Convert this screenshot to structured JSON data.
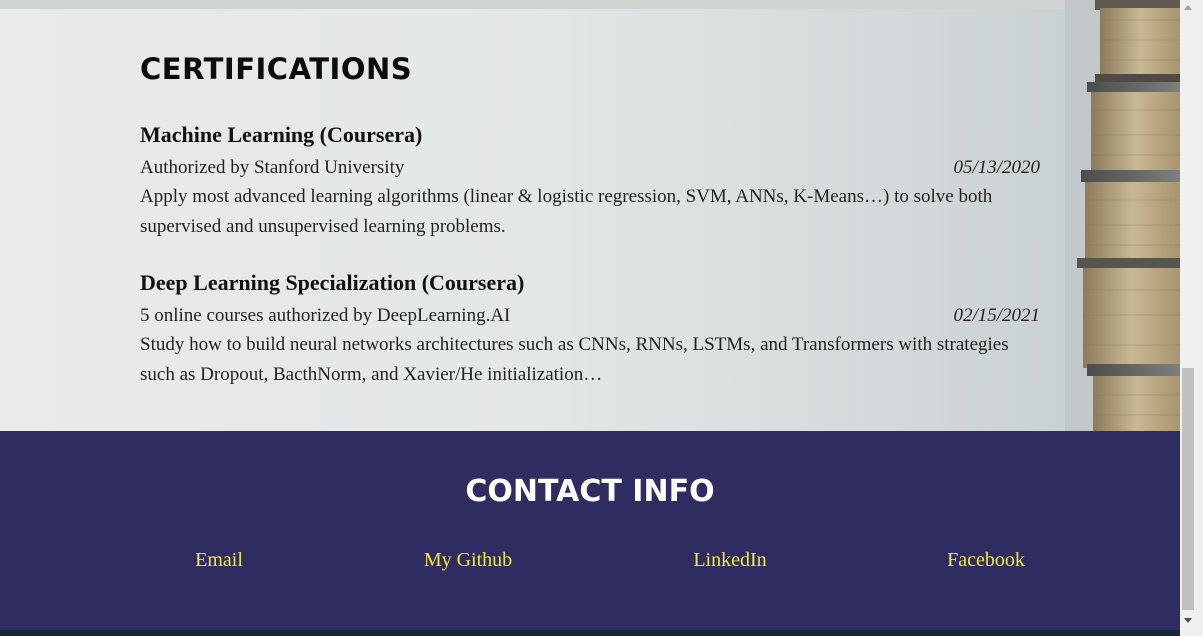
{
  "certifications": {
    "title": "CERTIFICATIONS",
    "items": [
      {
        "name": "Machine Learning (Coursera)",
        "issuer": "Authorized by Stanford University",
        "date": "05/13/2020",
        "description": "Apply most advanced learning algorithms (linear & logistic regression, SVM, ANNs, K-Means…) to solve both supervised and unsupervised learning problems."
      },
      {
        "name": "Deep Learning Specialization (Coursera)",
        "issuer": "5 online courses authorized by DeepLearning.AI",
        "date": "02/15/2021",
        "description": "Study how to build neural networks architectures such as CNNs, RNNs, LSTMs, and Transformers with strategies such as Dropout, BacthNorm, and Xavier/He initialization…"
      }
    ]
  },
  "contact": {
    "title": "CONTACT INFO",
    "links": [
      {
        "label": "Email"
      },
      {
        "label": "My Github"
      },
      {
        "label": "LinkedIn"
      },
      {
        "label": "Facebook"
      }
    ]
  },
  "colors": {
    "contact_bg": "#2f2c62",
    "link_color": "#f5e83a",
    "heading_color": "#0c0c0c"
  },
  "icons": {
    "scroll_up": "scroll-up-arrow-icon",
    "scroll_down": "scroll-down-arrow-icon",
    "background_image": "book-stack-image"
  }
}
